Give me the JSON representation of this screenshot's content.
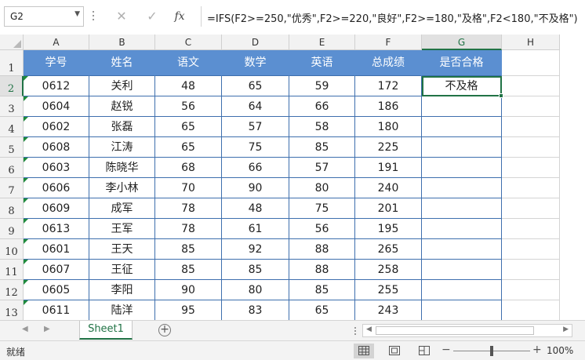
{
  "formula_bar": {
    "name_box": "G2",
    "cancel_icon": "✕",
    "enter_icon": "✓",
    "fx_label": "fx",
    "formula": "=IFS(F2>=250,\"优秀\",F2>=220,\"良好\",F2>=180,\"及格\",F2<180,\"不及格\")"
  },
  "grid": {
    "columns": [
      "A",
      "B",
      "C",
      "D",
      "E",
      "F",
      "G",
      "H"
    ],
    "selected_column": "G",
    "selected_row": "2",
    "row_numbers": [
      "1",
      "2",
      "3",
      "4",
      "5",
      "6",
      "7",
      "8",
      "9",
      "10",
      "11",
      "12",
      "13"
    ],
    "table_header": [
      "学号",
      "姓名",
      "语文",
      "数学",
      "英语",
      "总成绩",
      "是否合格"
    ],
    "rows": [
      [
        "0612",
        "关利",
        "48",
        "65",
        "59",
        "172",
        "不及格"
      ],
      [
        "0604",
        "赵锐",
        "56",
        "64",
        "66",
        "186",
        ""
      ],
      [
        "0602",
        "张磊",
        "65",
        "57",
        "58",
        "180",
        ""
      ],
      [
        "0608",
        "江涛",
        "65",
        "75",
        "85",
        "225",
        ""
      ],
      [
        "0603",
        "陈晓华",
        "68",
        "66",
        "57",
        "191",
        ""
      ],
      [
        "0606",
        "李小林",
        "70",
        "90",
        "80",
        "240",
        ""
      ],
      [
        "0609",
        "成军",
        "78",
        "48",
        "75",
        "201",
        ""
      ],
      [
        "0613",
        "王军",
        "78",
        "61",
        "56",
        "195",
        ""
      ],
      [
        "0601",
        "王天",
        "85",
        "92",
        "88",
        "265",
        ""
      ],
      [
        "0607",
        "王征",
        "85",
        "85",
        "88",
        "258",
        ""
      ],
      [
        "0605",
        "李阳",
        "90",
        "80",
        "85",
        "255",
        ""
      ],
      [
        "0611",
        "陆洋",
        "95",
        "83",
        "65",
        "243",
        ""
      ]
    ]
  },
  "sheet_tabs": {
    "tabs": [
      "Sheet1"
    ],
    "add_icon": "+"
  },
  "status_bar": {
    "status": "就绪",
    "zoom_minus": "−",
    "zoom_plus": "+",
    "zoom_level": "100%",
    "zoom_fraction": 0.5
  },
  "colors": {
    "header_fill": "#5b8fd1",
    "table_border": "#3e6fae",
    "accent": "#217346",
    "error_indicator": "#1e8a3c"
  }
}
